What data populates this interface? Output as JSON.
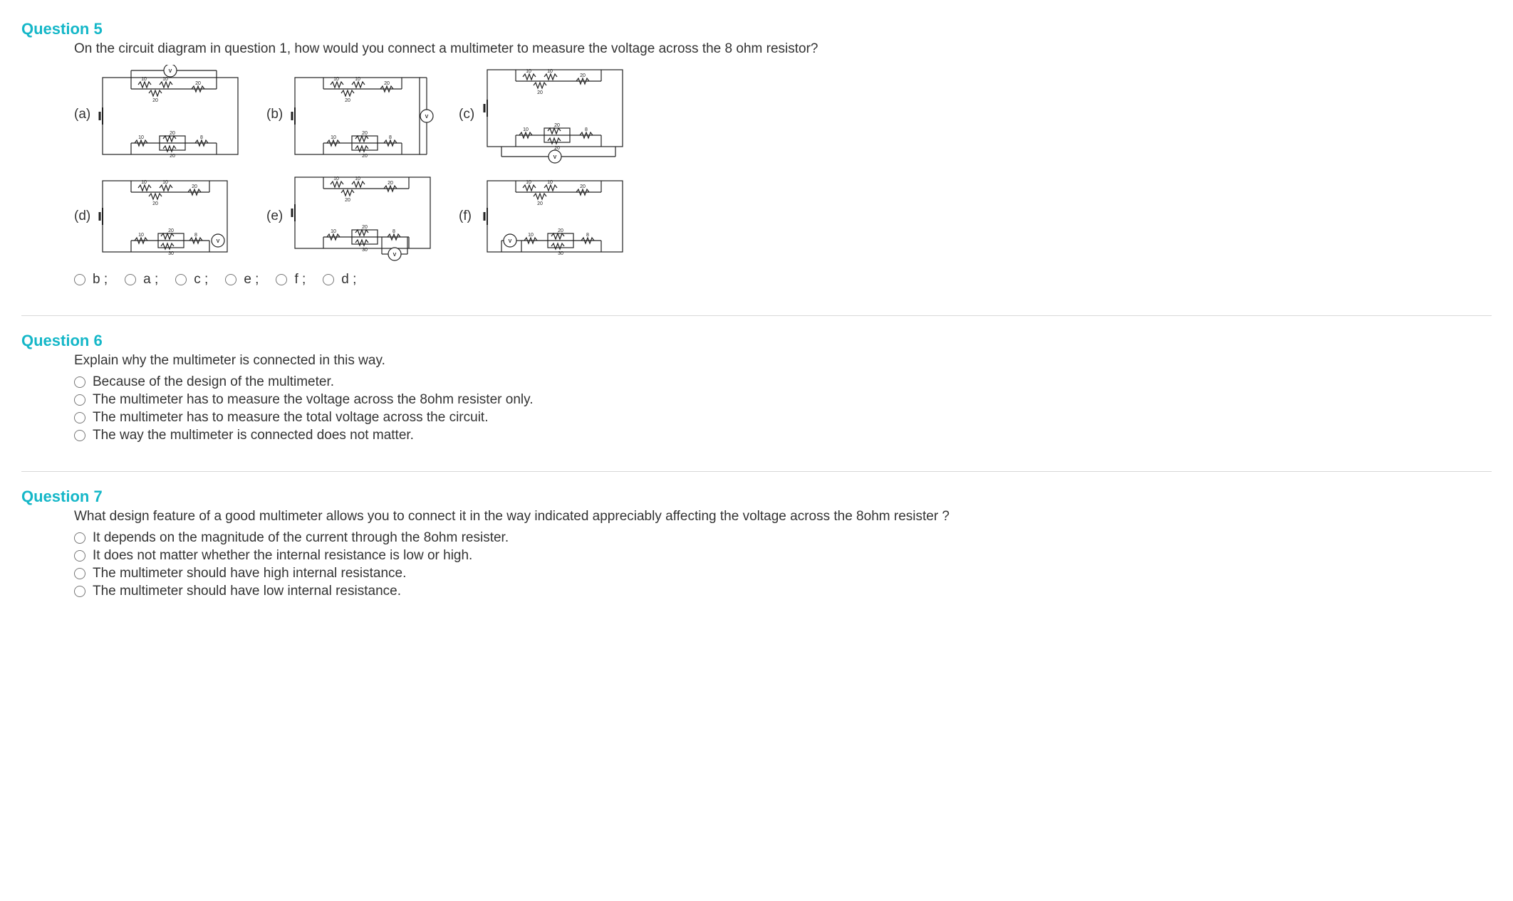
{
  "q5": {
    "title": "Question 5",
    "prompt": "On the circuit diagram in question 1, how would you connect a multimeter to measure the voltage across the 8 ohm resistor?",
    "diagram_labels": {
      "a": "(a)",
      "b": "(b)",
      "c": "(c)",
      "d": "(d)",
      "e": "(e)",
      "f": "(f)"
    },
    "options": [
      {
        "id": "q5-b",
        "label": "b ;"
      },
      {
        "id": "q5-a",
        "label": "a ;"
      },
      {
        "id": "q5-c",
        "label": "c ;"
      },
      {
        "id": "q5-e",
        "label": "e ;"
      },
      {
        "id": "q5-f",
        "label": "f ;"
      },
      {
        "id": "q5-d",
        "label": "d ;"
      }
    ]
  },
  "q6": {
    "title": "Question 6",
    "prompt": "Explain why the multimeter is connected in this way.",
    "options": [
      {
        "id": "q6-1",
        "label": "Because of the design of the multimeter."
      },
      {
        "id": "q6-2",
        "label": "The multimeter has to measure the voltage across the 8ohm resister only."
      },
      {
        "id": "q6-3",
        "label": "The multimeter has to measure the total voltage across the circuit."
      },
      {
        "id": "q6-4",
        "label": "The way the multimeter is connected does not matter."
      }
    ]
  },
  "q7": {
    "title": "Question 7",
    "prompt": "What design feature of a good multimeter allows you to connect it in the way indicated appreciably affecting the voltage across the 8ohm resister ?",
    "options": [
      {
        "id": "q7-1",
        "label": "It depends on the magnitude of the current through the 8ohm resister."
      },
      {
        "id": "q7-2",
        "label": "It does not matter whether the internal resistance is low or high."
      },
      {
        "id": "q7-3",
        "label": "The multimeter should have high internal resistance."
      },
      {
        "id": "q7-4",
        "label": "The multimeter should have low internal resistance."
      }
    ]
  },
  "circuit": {
    "r_top_left_pair": "10",
    "r_mid_top": "20",
    "r_right_top": "20",
    "r_bot_left": "10",
    "r_mid_bot_top": "20",
    "r_mid_bot_bot": "20",
    "r_par_30": "30",
    "r_right_bot": "8",
    "v_symbol": "V"
  }
}
